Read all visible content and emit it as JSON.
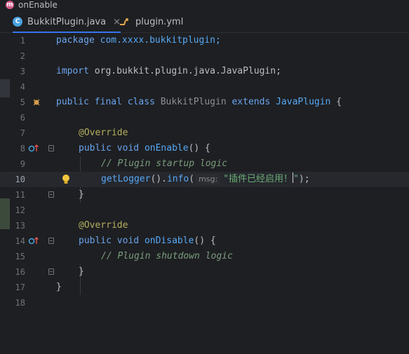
{
  "breadcrumb": {
    "icon_letter": "m",
    "label": "onEnable"
  },
  "tabs": [
    {
      "label": "BukkitPlugin.java",
      "icon": "java-class-icon",
      "close": "×"
    },
    {
      "label": "plugin.yml",
      "icon": "yaml-file-icon"
    }
  ],
  "editor": {
    "lines": [
      {
        "num": "1"
      },
      {
        "num": "2"
      },
      {
        "num": "3"
      },
      {
        "num": "4"
      },
      {
        "num": "5"
      },
      {
        "num": "6"
      },
      {
        "num": "7"
      },
      {
        "num": "8"
      },
      {
        "num": "9"
      },
      {
        "num": "10"
      },
      {
        "num": "11"
      },
      {
        "num": "12"
      },
      {
        "num": "13"
      },
      {
        "num": "14"
      },
      {
        "num": "15"
      },
      {
        "num": "16"
      },
      {
        "num": "17"
      },
      {
        "num": "18"
      }
    ],
    "code": {
      "l1_kw": "package",
      "l1_rest": " com.xxxx.bukkitplugin;",
      "l3_kw": "import",
      "l3_rest": " org.bukkit.plugin.java.JavaPlugin;",
      "l5_public": "public",
      "l5_final": "final",
      "l5_class": "class",
      "l5_name": "BukkitPlugin",
      "l5_extends": "extends",
      "l5_super": "JavaPlugin",
      "l5_brace": " {",
      "l7_ann": "@Override",
      "l8_public": "public",
      "l8_void": "void",
      "l8_method": "onEnable",
      "l8_rest": "() {",
      "l9_comment": "// Plugin startup logic",
      "l10_call": "getLogger",
      "l10_mid": "().",
      "l10_info": "info",
      "l10_paren": "(",
      "l10_hint": "msg:",
      "l10_str_a": "\"插件已经启用！",
      "l10_str_b": "\"",
      "l10_end": ");",
      "l11_brace": "}",
      "l13_ann": "@Override",
      "l14_public": "public",
      "l14_void": "void",
      "l14_method": "onDisable",
      "l14_rest": "() {",
      "l15_comment": "// Plugin shutdown logic",
      "l16_brace": "}",
      "l17_brace": "}"
    }
  },
  "colors": {
    "background": "#1e1f22",
    "keyword": "#cf8e6d",
    "annotation": "#b3ae60",
    "comment": "#7a9e7e",
    "string": "#6aab73",
    "accent": "#3574f0"
  }
}
